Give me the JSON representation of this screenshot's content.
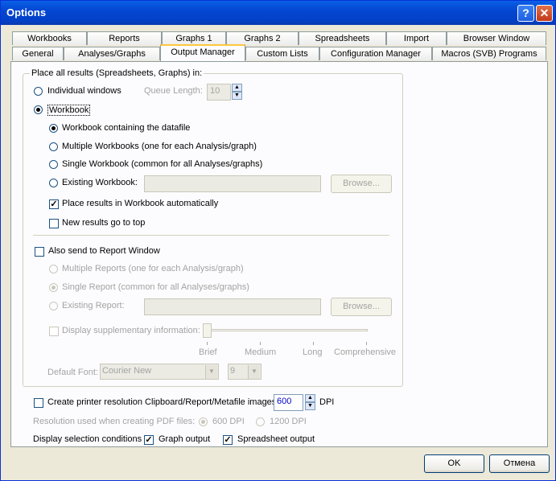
{
  "window": {
    "title": "Options",
    "help_label": "?",
    "close_label": "✕"
  },
  "tabs_row1": [
    "Workbooks",
    "Reports",
    "Graphs 1",
    "Graphs 2",
    "Spreadsheets",
    "Import",
    "Browser Window"
  ],
  "tabs_row2": [
    "General",
    "Analyses/Graphs",
    "Output Manager",
    "Custom Lists",
    "Configuration Manager",
    "Macros (SVB) Programs"
  ],
  "active_tab": "Output Manager",
  "placement": {
    "legend": "Place all results (Spreadsheets, Graphs) in:",
    "individual_windows": "Individual windows",
    "queue_length_label": "Queue Length:",
    "queue_length_value": "10",
    "workbook": "Workbook",
    "wb_datafile": "Workbook containing the datafile",
    "wb_multiple": "Multiple Workbooks (one for each Analysis/graph)",
    "wb_single": "Single Workbook (common for all Analyses/graphs)",
    "wb_existing": "Existing Workbook:",
    "browse": "Browse...",
    "place_auto": "Place results in Workbook automatically",
    "new_top": "New results go to top"
  },
  "report": {
    "also_send": "Also send to Report Window",
    "multiple": "Multiple Reports (one for each Analysis/graph)",
    "single": "Single Report (common for all Analyses/graphs)",
    "existing": "Existing Report:",
    "browse": "Browse...",
    "supplementary": "Display supplementary information:",
    "levels": [
      "Brief",
      "Medium",
      "Long",
      "Comprehensive"
    ],
    "default_font_label": "Default Font:",
    "font_value": "Courier New",
    "font_size_value": "9"
  },
  "bottom": {
    "printer_res": "Create printer resolution Clipboard/Report/Metafile images:",
    "dpi_value": "600",
    "dpi_unit": "DPI",
    "pdf_label": "Resolution used when creating PDF files:",
    "pdf_600": "600 DPI",
    "pdf_1200": "1200 DPI",
    "selection_label": "Display selection conditions",
    "graph_output": "Graph output",
    "spreadsheet_output": "Spreadsheet output"
  },
  "buttons": {
    "ok": "OK",
    "cancel": "Отмена"
  },
  "states": {
    "individual_windows": false,
    "workbook": true,
    "wb_mode": "datafile",
    "place_auto": true,
    "new_top": false,
    "also_send": false,
    "report_mode": "single",
    "printer_res": false,
    "pdf_mode": "600",
    "graph_output": true,
    "spreadsheet_output": true
  },
  "colors": {
    "titlebar": "#0447d2",
    "tab_highlight": "#ffc83c",
    "dialog_bg": "#ece9d8"
  }
}
